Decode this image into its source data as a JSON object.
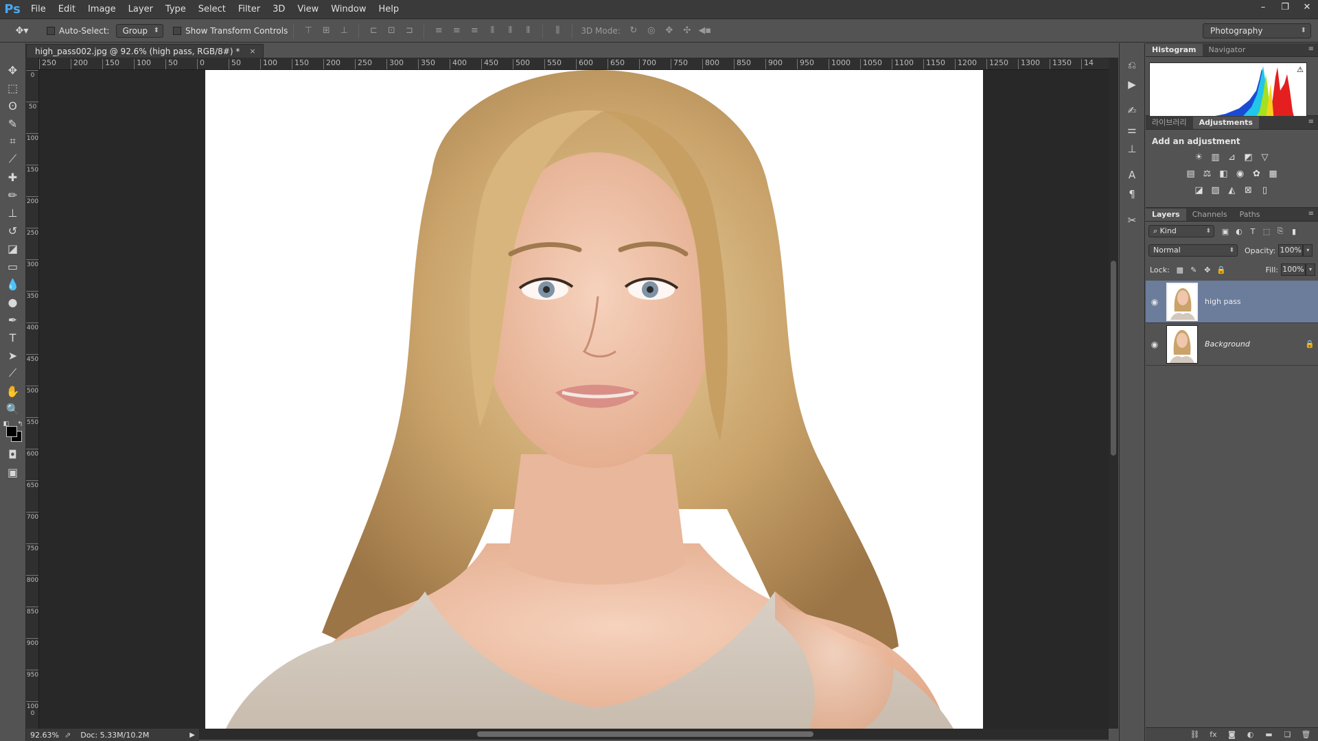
{
  "menubar": {
    "logo": "Ps",
    "items": [
      "File",
      "Edit",
      "Image",
      "Layer",
      "Type",
      "Select",
      "Filter",
      "3D",
      "View",
      "Window",
      "Help"
    ],
    "window_controls": [
      "–",
      "❐",
      "✕"
    ]
  },
  "options_bar": {
    "auto_select_label": "Auto-Select:",
    "auto_select_value": "Group",
    "transform_label": "Show Transform Controls",
    "mode_3d_label": "3D Mode:",
    "workspace": "Photography"
  },
  "document": {
    "tab_title": "high_pass002.jpg @ 92.6% (high pass, RGB/8#) *",
    "close_glyph": "×",
    "ruler_h": [
      "250",
      "200",
      "150",
      "100",
      "50",
      "0",
      "50",
      "100",
      "150",
      "200",
      "250",
      "300",
      "350",
      "400",
      "450",
      "500",
      "550",
      "600",
      "650",
      "700",
      "750",
      "800",
      "850",
      "900",
      "950",
      "1000",
      "1050",
      "1100",
      "1150",
      "1200",
      "1250",
      "1300",
      "1350",
      "14"
    ],
    "ruler_v": [
      "0",
      "50",
      "100",
      "150",
      "200",
      "250",
      "300",
      "350",
      "400",
      "450",
      "500",
      "550",
      "600",
      "650",
      "700",
      "750",
      "800",
      "850",
      "900",
      "950",
      "1000"
    ]
  },
  "status": {
    "zoom": "92.63%",
    "doc": "Doc: 5.33M/10.2M"
  },
  "panels": {
    "histogram_tabs": [
      "Histogram",
      "Navigator"
    ],
    "histogram_warning": "⚠",
    "adjust_tabs": [
      "라이브러리",
      "Adjustments"
    ],
    "adjust_title": "Add an adjustment",
    "layers_tabs": [
      "Layers",
      "Channels",
      "Paths"
    ],
    "kind_label": "Kind",
    "blend_mode": "Normal",
    "opacity_label": "Opacity:",
    "opacity_value": "100%",
    "lock_label": "Lock:",
    "fill_label": "Fill:",
    "fill_value": "100%",
    "layers": [
      {
        "name": "high pass",
        "selected": true
      },
      {
        "name": "Background",
        "selected": false,
        "locked": true
      }
    ]
  },
  "colors": {
    "accent_selected_layer": "#6c7d9c",
    "ps_logo": "#4aa8f0"
  }
}
